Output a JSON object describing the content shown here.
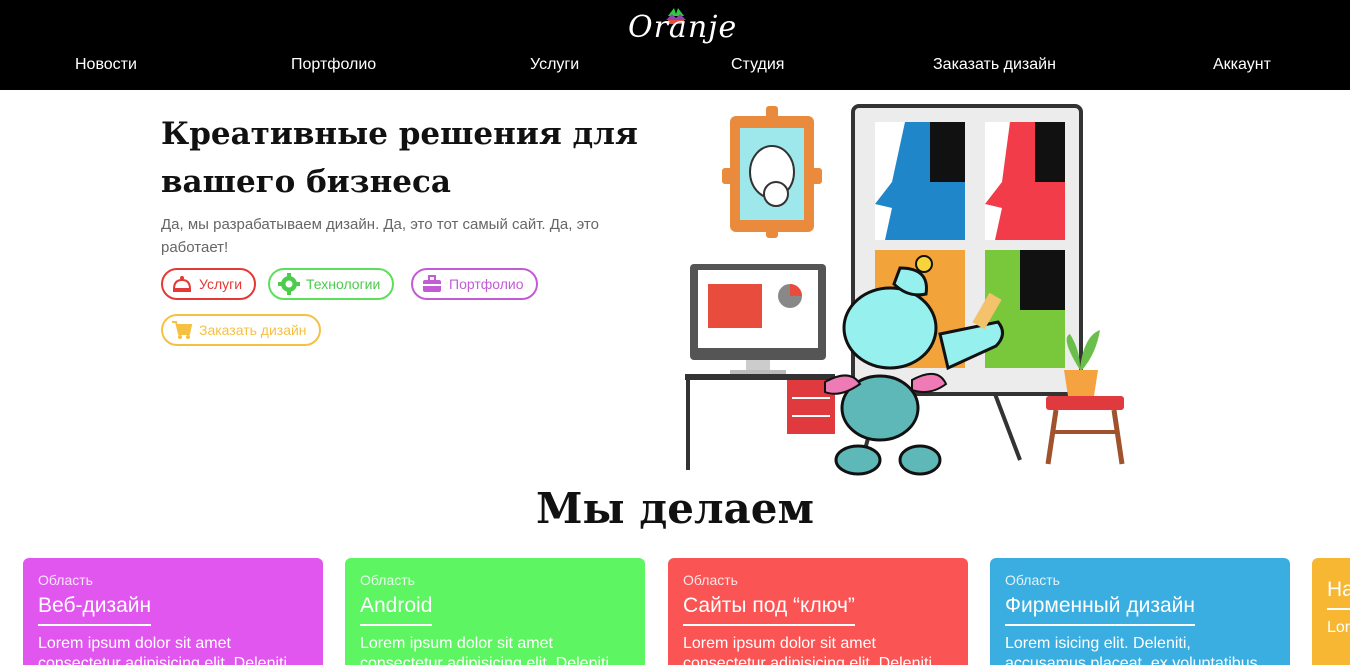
{
  "header": {
    "logo_text": "Oranje",
    "nav": [
      {
        "label": "Новости"
      },
      {
        "label": "Портфолио"
      },
      {
        "label": "Услуги"
      },
      {
        "label": "Студия"
      },
      {
        "label": "Заказать дизайн"
      },
      {
        "label": "Аккаунт"
      }
    ]
  },
  "hero": {
    "title": "Креативные решения для вашего бизнеса",
    "subtitle": "Да, мы разрабатываем дизайн. Да, это тот самый сайт. Да, это работает!",
    "buttons": [
      {
        "label": "Услуги",
        "icon": "bell-icon",
        "color": "#e53935"
      },
      {
        "label": "Технологии",
        "icon": "gear-icon",
        "color": "#5be05b"
      },
      {
        "label": "Портфолио",
        "icon": "briefcase-icon",
        "color": "#c45bd6"
      },
      {
        "label": "Заказать дизайн",
        "icon": "cart-icon",
        "color": "#f6c143"
      }
    ]
  },
  "section": {
    "title": "Мы делаем"
  },
  "cards": [
    {
      "kicker": "Область",
      "title": "Веб-дизайн",
      "body": "Lorem ipsum dolor sit amet consectetur adipisicing elit. Deleniti",
      "color": "#e256f0"
    },
    {
      "kicker": "Область",
      "title": "Android",
      "body": "Lorem ipsum dolor sit amet consectetur adipisicing elit. Deleniti",
      "color": "#5ef562"
    },
    {
      "kicker": "Область",
      "title": "Сайты под “ключ”",
      "body": "Lorem ipsum dolor sit amet consectetur adipisicing elit. Deleniti",
      "color": "#fa5454"
    },
    {
      "kicker": "Область",
      "title": "Фирменный дизайн",
      "body": "Lorem isicing elit. Deleniti, accusamus placeat, ex voluptatibus",
      "color": "#3aaee0"
    },
    {
      "kicker": "",
      "title": "На",
      "body": "Lor",
      "color": "#f7b733"
    }
  ]
}
